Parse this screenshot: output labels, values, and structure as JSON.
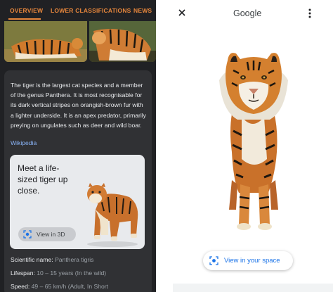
{
  "left_panel": {
    "tabs": [
      {
        "label": "OVERVIEW"
      },
      {
        "label": "LOWER CLASSIFICATIONS"
      },
      {
        "label": "NEWS"
      }
    ],
    "description": "The tiger is the largest cat species and a member of the genus Panthera. It is most recognisable for its dark vertical stripes on orangish-brown fur with a lighter underside. It is an apex predator, primarily preying on ungulates such as deer and wild boar.",
    "source_link": "Wikipedia",
    "promo": {
      "text": "Meet a life-sized tiger up close.",
      "button_label": "View in 3D"
    },
    "facts": [
      {
        "label": "Scientific name:",
        "value": "Panthera tigris"
      },
      {
        "label": "Lifespan:",
        "value": "10 – 15 years (In the wild)"
      },
      {
        "label": "Speed:",
        "value": "49 – 65 km/h (Adult, In Short"
      }
    ]
  },
  "viewer": {
    "title": "Google",
    "close_icon": "close-icon",
    "menu_icon": "more-vert-icon",
    "button_label": "View in your space"
  },
  "colors": {
    "accent_orange": "#e8873c",
    "link_blue": "#8ab4f8",
    "button_blue": "#1a73e8",
    "dark_bg": "#202124",
    "card_bg": "#303134"
  }
}
